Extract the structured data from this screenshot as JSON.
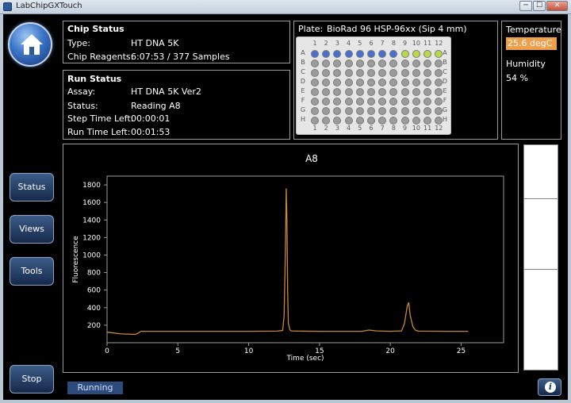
{
  "window": {
    "title": "LabChipGXTouch",
    "min_glyph": "─",
    "max_glyph": "☐",
    "close_glyph": "✕"
  },
  "nav": {
    "status": "Status",
    "views": "Views",
    "tools": "Tools",
    "stop": "Stop"
  },
  "chip_status": {
    "title": "Chip Status",
    "rows": [
      {
        "label": "Type:",
        "value": "HT DNA 5K"
      },
      {
        "label": "Chip Reagents:",
        "value": "6:07:53 / 377 Samples"
      }
    ]
  },
  "run_status": {
    "title": "Run Status",
    "rows": [
      {
        "label": "Assay:",
        "value": "HT DNA 5K Ver2"
      },
      {
        "label": "Status:",
        "value": "Reading A8"
      },
      {
        "label": "Step Time Left:",
        "value": "00:00:01"
      },
      {
        "label": "Run Time Left:",
        "value": "00:01:53"
      }
    ]
  },
  "plate": {
    "label": "Plate:",
    "name": "BioRad 96 HSP-96xx  (Sip 4 mm)",
    "columns": [
      "1",
      "2",
      "3",
      "4",
      "5",
      "6",
      "7",
      "8",
      "9",
      "10",
      "11",
      "12"
    ],
    "rows": [
      "A",
      "B",
      "C",
      "D",
      "E",
      "F",
      "G",
      "H"
    ],
    "row_a_states": [
      "done",
      "done",
      "done",
      "done",
      "done",
      "done",
      "done",
      "done",
      "pending",
      "pending",
      "pending",
      "pending"
    ],
    "colors": {
      "done": "#4a6fcf",
      "pending": "#b9d94a",
      "empty": "#9b9b9b"
    }
  },
  "environment": {
    "temperature_label": "Temperature",
    "temperature_value": "25.6 degC",
    "humidity_label": "Humidity",
    "humidity_value": "54 %"
  },
  "status_bar": {
    "state": "Running",
    "info_glyph": "i"
  },
  "chart_data": {
    "type": "line",
    "title": "A8",
    "xlabel": "Time (sec)",
    "ylabel": "Fluorescence",
    "xlim": [
      0,
      28
    ],
    "ylim": [
      0,
      1900
    ],
    "xticks": [
      0,
      5,
      10,
      15,
      20,
      25
    ],
    "yticks": [
      200,
      400,
      600,
      800,
      1000,
      1200,
      1400,
      1600,
      1800
    ],
    "grid": false,
    "color": "#c8893a",
    "series": [
      {
        "x": [
          0,
          1,
          2,
          2.2,
          2.4,
          3,
          5,
          8,
          10,
          12,
          12.4,
          12.5,
          12.6,
          12.65,
          12.7,
          12.75,
          12.8,
          12.9,
          13,
          13.5,
          15,
          18,
          18.5,
          19,
          20,
          20.8,
          21,
          21.2,
          21.3,
          21.4,
          21.6,
          21.8,
          22,
          24,
          25.5
        ],
        "y": [
          120,
          100,
          95,
          110,
          130,
          130,
          130,
          130,
          130,
          132,
          140,
          300,
          1100,
          1760,
          1400,
          600,
          220,
          150,
          135,
          132,
          130,
          130,
          145,
          135,
          130,
          135,
          220,
          420,
          460,
          320,
          180,
          140,
          132,
          130,
          130
        ]
      }
    ]
  }
}
